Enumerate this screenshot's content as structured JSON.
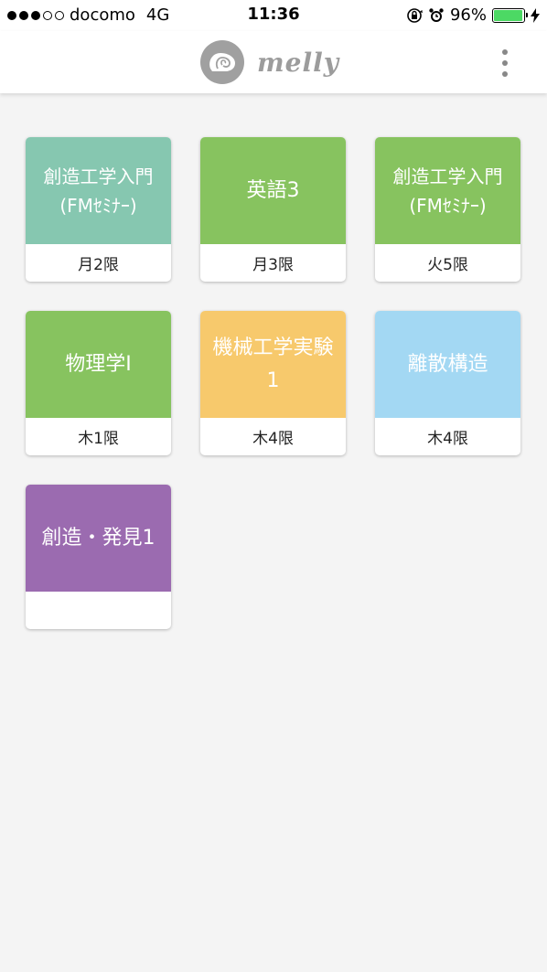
{
  "status_bar": {
    "carrier": "docomo",
    "network": "4G",
    "time": "11:36",
    "battery_percent_text": "96%",
    "battery_level": 0.96,
    "battery_color": "#4cd964"
  },
  "header": {
    "brand": "melly",
    "logo_icon": "ammonite-shell-icon",
    "menu_icon": "more-vertical-icon"
  },
  "courses": [
    {
      "title_line1": "創造工学入門",
      "title_line2": "(FMｾﾐﾅｰ)",
      "period": "月2限",
      "color": "#86c7b0"
    },
    {
      "title_line1": "英語3",
      "title_line2": "",
      "period": "月3限",
      "color": "#87c35f"
    },
    {
      "title_line1": "創造工学入門",
      "title_line2": "(FMｾﾐﾅｰ)",
      "period": "火5限",
      "color": "#87c35f"
    },
    {
      "title_line1": "物理学I",
      "title_line2": "",
      "period": "木1限",
      "color": "#87c35f"
    },
    {
      "title_line1": "機械工学実験",
      "title_line2": "1",
      "period": "木4限",
      "color": "#f7c96c"
    },
    {
      "title_line1": "離散構造",
      "title_line2": "",
      "period": "木4限",
      "color": "#a3d8f3"
    },
    {
      "title_line1": "創造・発見1",
      "title_line2": "",
      "period": "",
      "color": "#9b6bb0"
    }
  ]
}
